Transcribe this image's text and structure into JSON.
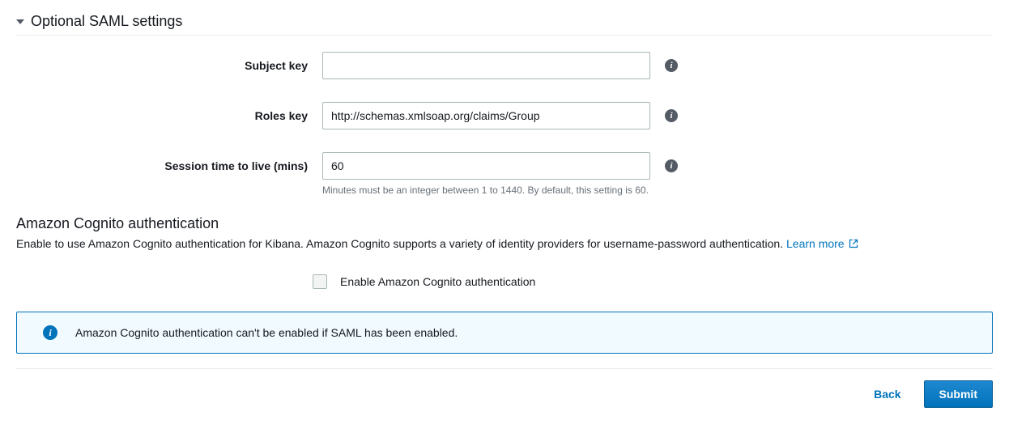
{
  "saml": {
    "title": "Optional SAML settings",
    "fields": {
      "subject_key": {
        "label": "Subject key",
        "value": ""
      },
      "roles_key": {
        "label": "Roles key",
        "value": "http://schemas.xmlsoap.org/claims/Group"
      },
      "session_ttl": {
        "label": "Session time to live (mins)",
        "value": "60",
        "help": "Minutes must be an integer between 1 to 1440. By default, this setting is 60."
      }
    }
  },
  "cognito": {
    "title": "Amazon Cognito authentication",
    "description": "Enable to use Amazon Cognito authentication for Kibana. Amazon Cognito supports a variety of identity providers for username-password authentication.",
    "learn_more": "Learn more",
    "checkbox_label": "Enable Amazon Cognito authentication",
    "alert": "Amazon Cognito authentication can't be enabled if SAML has been enabled."
  },
  "buttons": {
    "back": "Back",
    "submit": "Submit"
  }
}
